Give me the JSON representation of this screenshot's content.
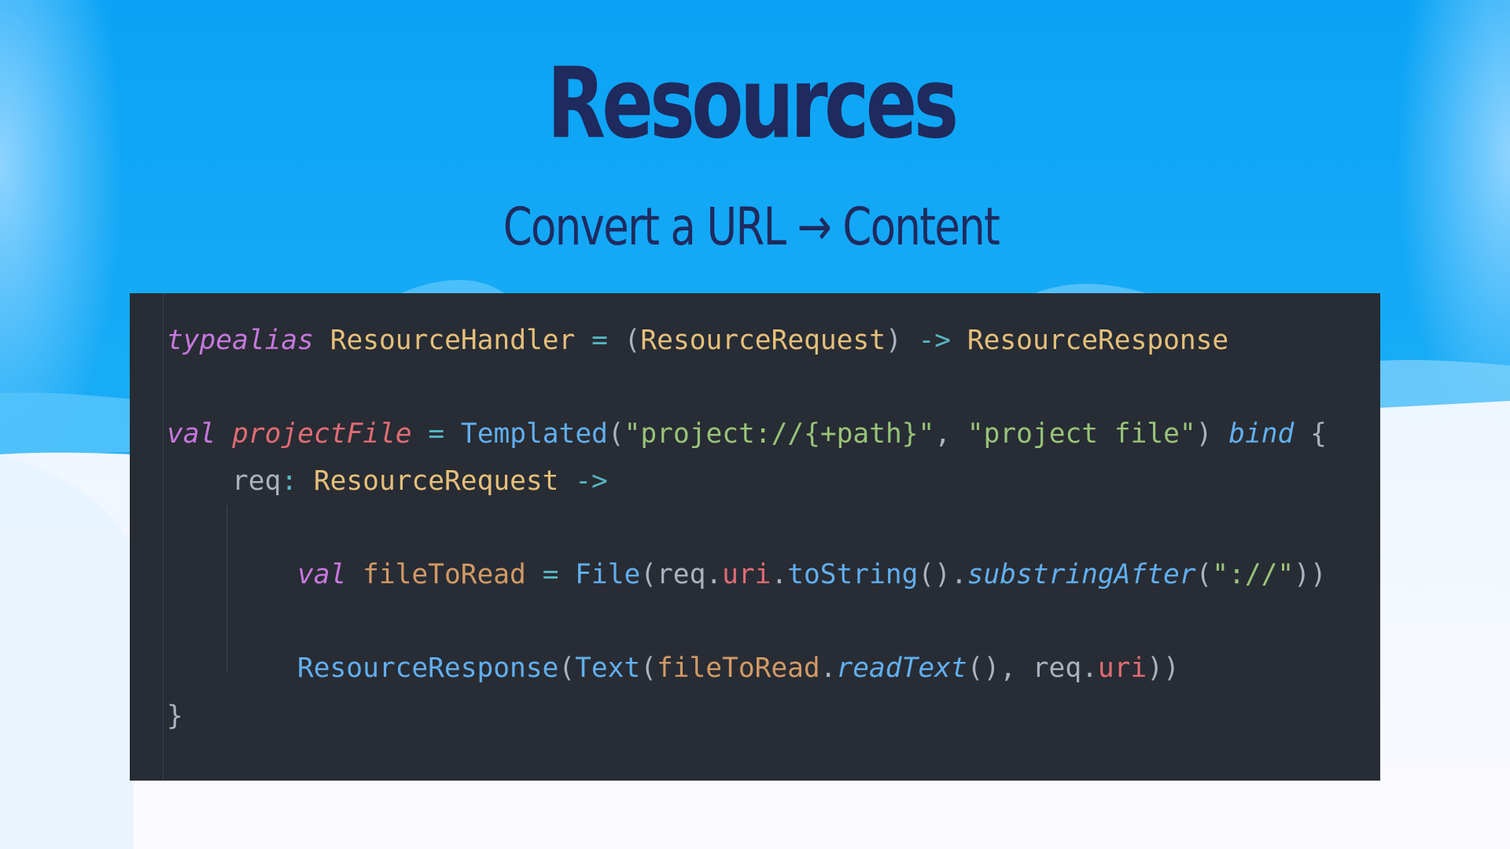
{
  "slide": {
    "title": "Resources",
    "subtitle": "Convert a URL → Content"
  },
  "colors": {
    "sky_top": "#0aa3f5",
    "sky_bottom": "#26b2f7",
    "snow": "#f4f8ff",
    "title_text": "#1f2a5e",
    "code_bg": "#282c34"
  },
  "code": {
    "line1": {
      "kw": "typealias",
      "name": "ResourceHandler",
      "eq": "=",
      "lparen": "(",
      "param_type": "ResourceRequest",
      "rparen": ")",
      "arrow": "->",
      "return_type": "ResourceResponse"
    },
    "line2": {
      "kw": "val",
      "name": "projectFile",
      "eq": "=",
      "fn": "Templated",
      "lparen": "(",
      "str1": "\"project://{+path}\"",
      "comma": ",",
      "str2": "\"project file\"",
      "rparen": ")",
      "bind": "bind",
      "brace": "{"
    },
    "line3": {
      "param": "req",
      "colon": ":",
      "type": "ResourceRequest",
      "arrow": "->"
    },
    "line4": {
      "kw": "val",
      "name": "fileToRead",
      "eq": "=",
      "fn": "File",
      "lparen": "(",
      "recv": "req",
      "dot1": ".",
      "prop": "uri",
      "dot2": ".",
      "call1": "toString",
      "parens": "()",
      "dot3": ".",
      "call2": "substringAfter",
      "lparen2": "(",
      "str": "\"://\"",
      "close": "))"
    },
    "line5": {
      "fn1": "ResourceResponse",
      "lparen1": "(",
      "fn2": "Text",
      "lparen2": "(",
      "recv": "fileToRead",
      "dot1": ".",
      "call": "readText",
      "parens": "()",
      "comma": ",",
      "recv2": "req",
      "dot2": ".",
      "prop": "uri",
      "close": "))"
    },
    "line6": {
      "brace": "}"
    }
  }
}
